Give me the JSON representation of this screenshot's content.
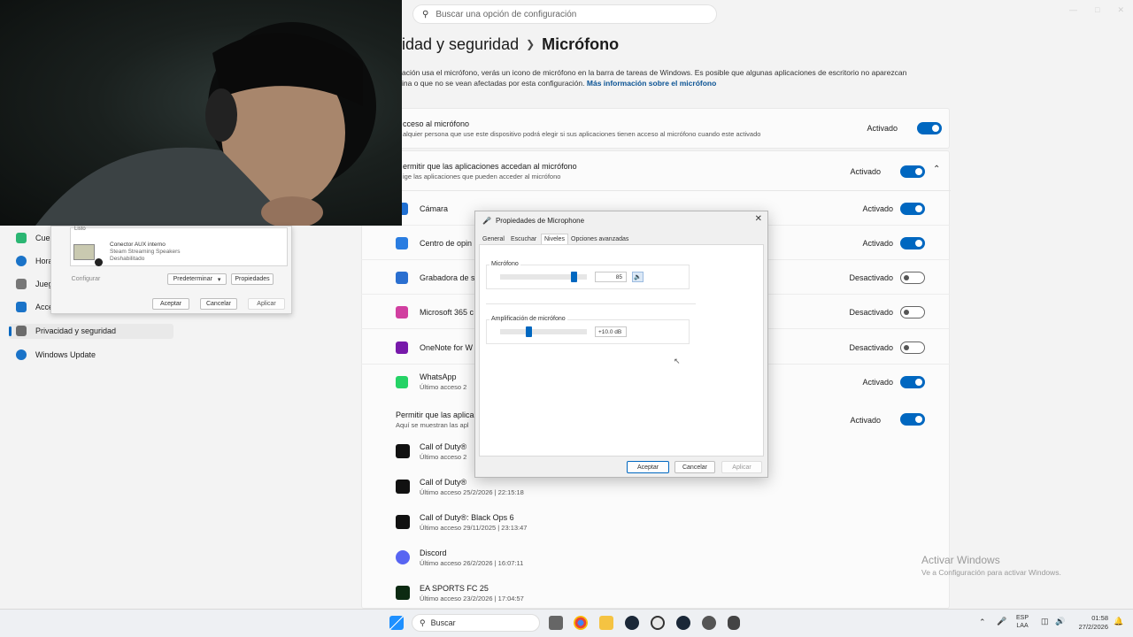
{
  "settings": {
    "search_placeholder": "Buscar una opción de configuración",
    "breadcrumb_parent": "idad y seguridad",
    "breadcrumb_current": "Micrófono",
    "description": "ación usa el micrófono, verás un icono de micrófono en la barra de tareas de Windows. Es posible que algunas aplicaciones de escritorio no aparezcan",
    "description_line2": "ina o que no se vean afectadas por esta configuración.",
    "more_info_link": "Más información sobre el micrófono",
    "access_title": "cceso al micrófono",
    "access_sub": "alquier persona que use este dispositivo podrá elegir si sus aplicaciones tienen acceso al micrófono cuando este activado",
    "access_state": "Activado",
    "apps_title": "ermitir que las aplicaciones accedan al micrófono",
    "apps_sub": "ige las aplicaciones que pueden acceder al micrófono",
    "apps_state": "Activado",
    "apps": [
      {
        "name": "Cámara",
        "state": "Activado",
        "on": true,
        "color": "#1f6fd1",
        "icon": "camera-icon"
      },
      {
        "name": "Centro de opin",
        "state": "Activado",
        "on": true,
        "color": "#2a7de1",
        "icon": "feedback-icon"
      },
      {
        "name": "Grabadora de s",
        "state": "Desactivado",
        "on": false,
        "color": "#2a6fd0",
        "icon": "recorder-icon"
      },
      {
        "name": "Microsoft 365 c",
        "state": "Desactivado",
        "on": false,
        "color": "#d13fa0",
        "icon": "m365-icon"
      },
      {
        "name": "OneNote for W",
        "state": "Desactivado",
        "on": false,
        "color": "#7719aa",
        "icon": "onenote-icon"
      },
      {
        "name": "WhatsApp",
        "sub": "Último acceso 2",
        "state": "Activado",
        "on": true,
        "color": "#25d366",
        "icon": "whatsapp-icon"
      }
    ],
    "desktop_title": "Permitir que las aplica",
    "desktop_sub": "Aquí se muestran las apl",
    "desktop_state": "Activado",
    "desktop_apps": [
      {
        "name": "Call of Duty®",
        "sub": "Último acceso 2"
      },
      {
        "name": "Call of Duty®",
        "sub": "Último acceso 25/2/2026  |  22:15:18"
      },
      {
        "name": "Call of Duty®: Black Ops 6",
        "sub": "Último acceso 29/11/2025  |  23:13:47"
      },
      {
        "name": "Discord",
        "sub": "Último acceso 26/2/2026  |  16:07:11"
      },
      {
        "name": "EA SPORTS FC 25",
        "sub": "Último acceso 23/2/2026  |  17:04:57"
      }
    ]
  },
  "nav": [
    {
      "label": "Cue",
      "icon": "accounts-icon",
      "color": "#2bb673"
    },
    {
      "label": "Hora",
      "icon": "time-icon",
      "color": "#1a73c8"
    },
    {
      "label": "Jueg",
      "icon": "gaming-icon",
      "color": "#777"
    },
    {
      "label": "Acce",
      "icon": "accessibility-icon",
      "color": "#1a73c8"
    },
    {
      "label": "Privacidad y seguridad",
      "icon": "shield-icon",
      "color": "#6b6b6b"
    },
    {
      "label": "Windows Update",
      "icon": "update-icon",
      "color": "#1a73c8"
    }
  ],
  "sound_dialog": {
    "status": "Listo",
    "device_name": "Conector AUX interno",
    "device_line2": "Steam Streaming Speakers",
    "device_line3": "Deshabilitado",
    "configure": "Configurar",
    "set_default": "Predeterminar",
    "properties": "Propiedades",
    "accept": "Aceptar",
    "cancel": "Cancelar",
    "apply": "Aplicar"
  },
  "mic_dialog": {
    "title": "Propiedades de Microphone",
    "tabs": [
      "General",
      "Escuchar",
      "Niveles",
      "Opciones avanzadas"
    ],
    "mic_label": "Micrófono",
    "mic_value": "85",
    "mic_level": 0.85,
    "boost_label": "Amplificación de micrófono",
    "boost_value": "+10.0 dB",
    "boost_level": 0.33,
    "accept": "Aceptar",
    "cancel": "Cancelar",
    "apply": "Aplicar"
  },
  "watermark": {
    "title": "Activar Windows",
    "sub": "Ve a Configuración para activar Windows."
  },
  "taskbar": {
    "search": "Buscar",
    "lang1": "ESP",
    "lang2": "LAA",
    "time": "01:58",
    "date": "27/2/2026"
  }
}
